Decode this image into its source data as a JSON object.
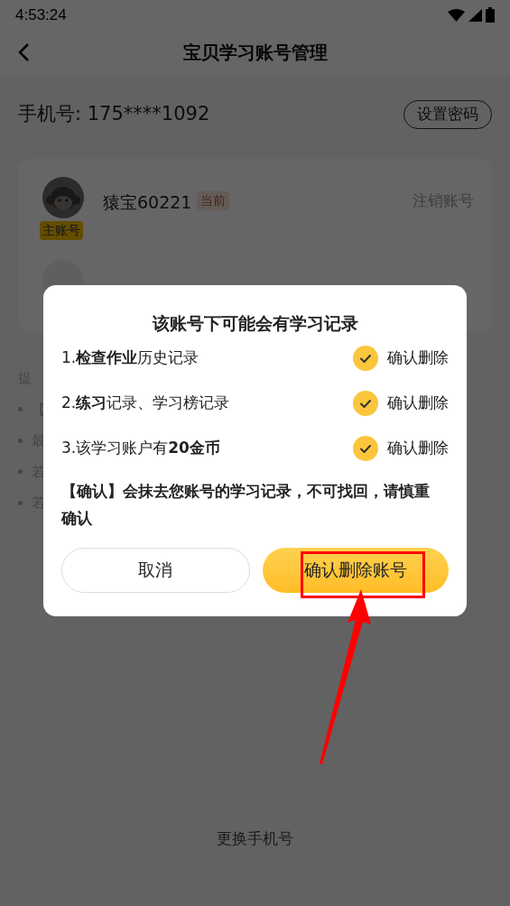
{
  "status_bar": {
    "time": "4:53:24"
  },
  "header": {
    "title": "宝贝学习账号管理"
  },
  "phone": {
    "label": "手机号: 175****1092",
    "button": "设置密码"
  },
  "accounts": [
    {
      "name": "猿宝60221",
      "tag": "当前",
      "badge": "主账号",
      "action": "注销账号",
      "kind": "account"
    },
    {
      "kind": "placeholder"
    }
  ],
  "tips": {
    "title": "提",
    "items": [
      "【",
      "最",
      "若",
      "若"
    ]
  },
  "footer_link": "更换手机号",
  "dialog": {
    "title": "该账号下可能会有学习记录",
    "items": [
      {
        "text": "1.**检查作业**历史记录",
        "checked": true,
        "label": "确认删除"
      },
      {
        "text": "2.**练习**记录、学习榜记录",
        "checked": true,
        "label": "确认删除"
      },
      {
        "text": "3.该学习账户有**20金币**",
        "checked": true,
        "label": "确认删除"
      }
    ],
    "note": "【确认】会抹去您账号的学习记录，不可找回，请慎重确认",
    "cancel": "取消",
    "confirm": "确认删除账号"
  },
  "annotation": {
    "box": true,
    "arrow": true
  }
}
